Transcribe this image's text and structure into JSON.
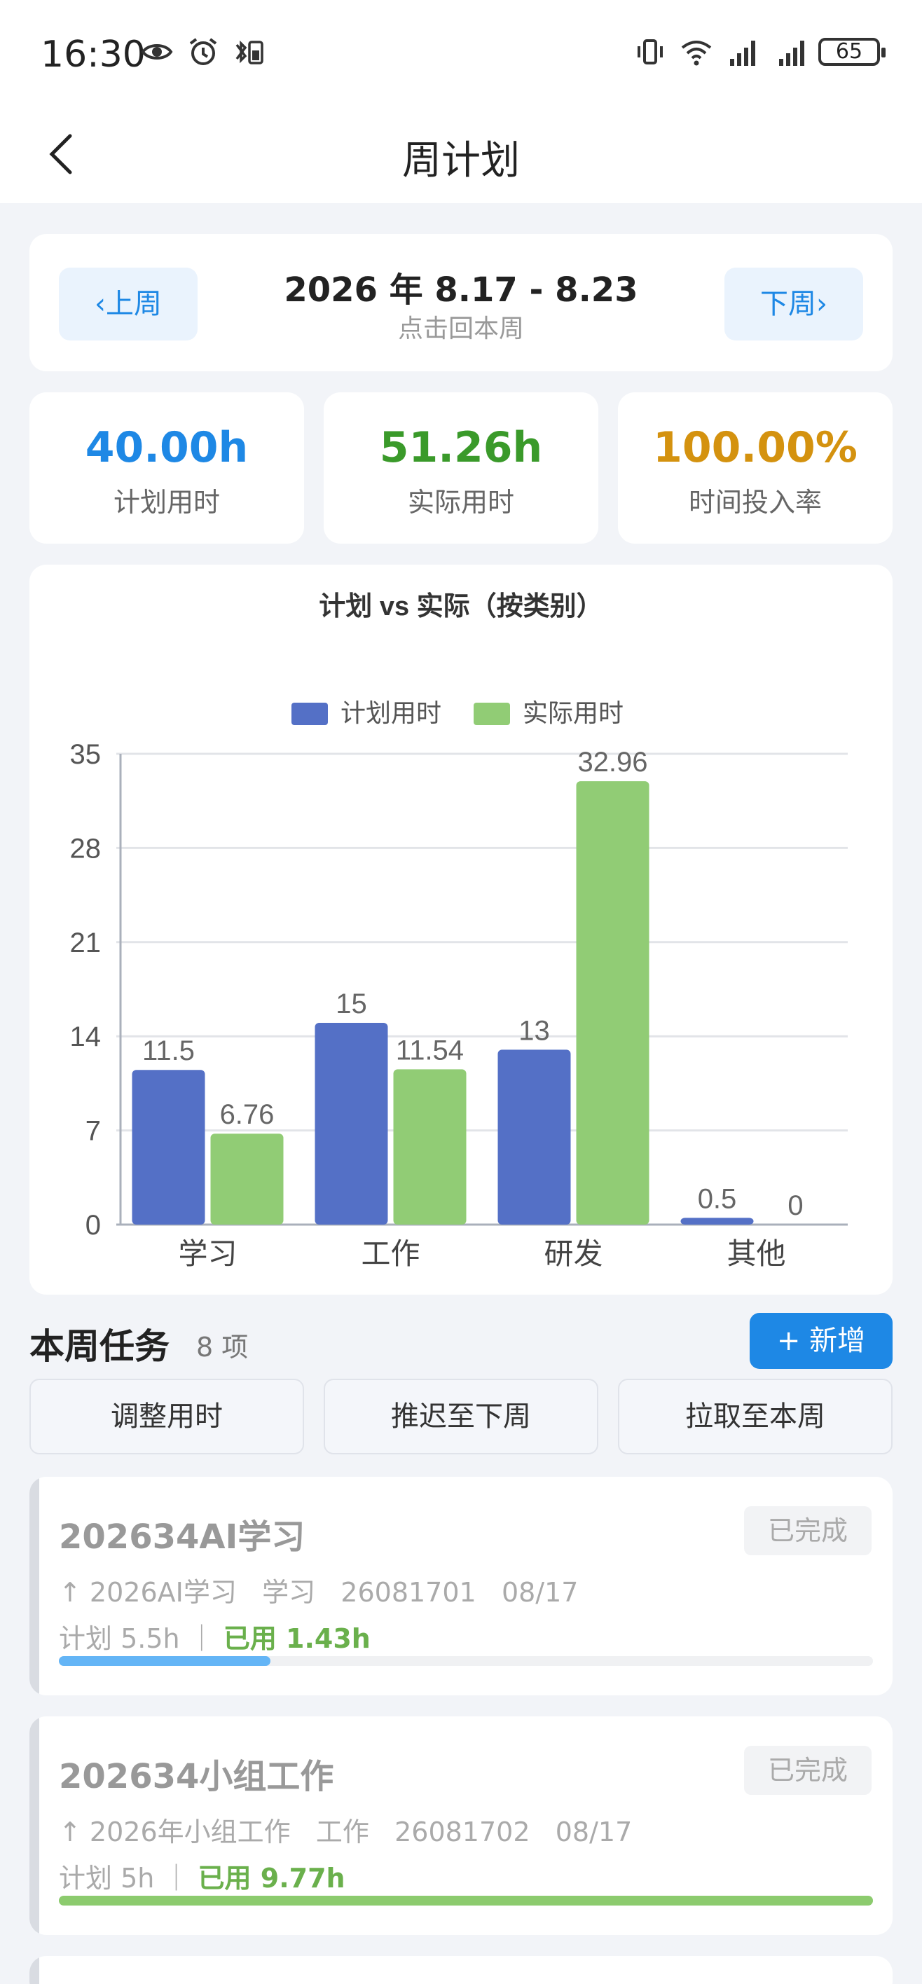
{
  "status_bar": {
    "time": "16:30",
    "battery": "65"
  },
  "header": {
    "title": "周计划"
  },
  "week": {
    "prev_label": "‹上周",
    "next_label": "下周›",
    "range": "2026 年 8.17 - 8.23",
    "hint": "点击回本周"
  },
  "stats": [
    {
      "value": "40.00h",
      "label": "计划用时",
      "color": "#1e88e5"
    },
    {
      "value": "51.26h",
      "label": "实际用时",
      "color": "#3a9a2a"
    },
    {
      "value": "100.00%",
      "label": "时间投入率",
      "color": "#d4920f"
    }
  ],
  "chart_data": {
    "type": "bar",
    "title": "计划 vs 实际（按类别）",
    "categories": [
      "学习",
      "工作",
      "研发",
      "其他"
    ],
    "series": [
      {
        "name": "计划用时",
        "color": "#5470c6",
        "values": [
          11.5,
          15,
          13,
          0.5
        ],
        "labels": [
          "11.5",
          "15",
          "13",
          "0.5"
        ]
      },
      {
        "name": "实际用时",
        "color": "#91cc75",
        "values": [
          6.76,
          11.54,
          32.96,
          0
        ],
        "labels": [
          "6.76",
          "11.54",
          "32.96",
          "0"
        ]
      }
    ],
    "ylim": [
      0,
      35
    ],
    "yticks": [
      "0",
      "7",
      "14",
      "21",
      "28",
      "35"
    ],
    "legend": "top-center",
    "grid": true
  },
  "tasks_section": {
    "title": "本周任务",
    "count": "8 项",
    "add_label": "+ 新增",
    "actions": [
      "调整用时",
      "推迟至下周",
      "拉取至本周"
    ]
  },
  "tasks": [
    {
      "name": "202634AI学习",
      "status": "已完成",
      "meta": "↑ 2026AI学习   学习   26081701   08/17",
      "plan": "计划 5.5h",
      "separator": "｜",
      "used": "已用 1.43h",
      "progress": 0.26,
      "bar_color": "#64b5f6"
    },
    {
      "name": "202634小组工作",
      "status": "已完成",
      "meta": "↑ 2026年小组工作   工作   26081702   08/17",
      "plan": "计划 5h",
      "separator": "｜",
      "used": "已用 9.77h",
      "progress": 1.0,
      "bar_color": "#8ccb6e"
    }
  ]
}
